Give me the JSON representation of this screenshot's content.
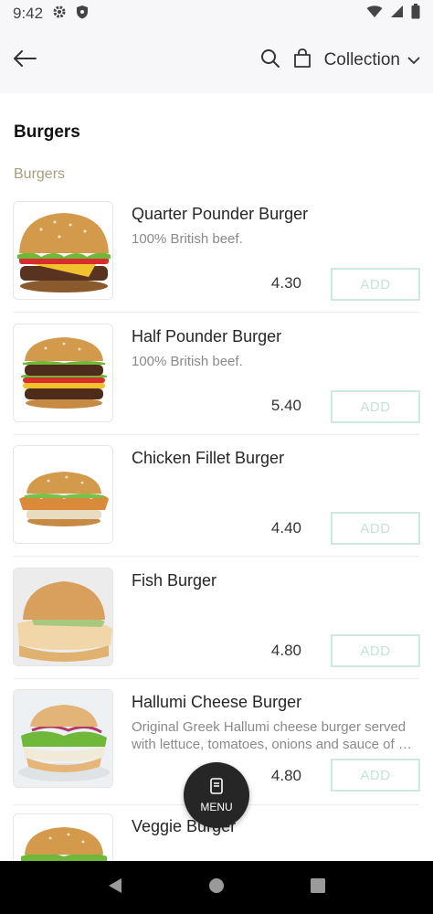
{
  "status": {
    "time": "9:42"
  },
  "header": {
    "collection_label": "Collection"
  },
  "page": {
    "title": "Burgers",
    "section": "Burgers"
  },
  "items": [
    {
      "name": "Quarter Pounder Burger",
      "desc": "100% British beef.",
      "price": "4.30",
      "add_label": "ADD"
    },
    {
      "name": "Half Pounder Burger",
      "desc": "100% British beef.",
      "price": "5.40",
      "add_label": "ADD"
    },
    {
      "name": "Chicken Fillet Burger",
      "desc": "",
      "price": "4.40",
      "add_label": "ADD"
    },
    {
      "name": "Fish Burger",
      "desc": "",
      "price": "4.80",
      "add_label": "ADD"
    },
    {
      "name": "Hallumi Cheese Burger",
      "desc": "Original Greek Hallumi cheese burger served with lettuce, tomatoes, onions and sauce of …",
      "price": "4.80",
      "add_label": "ADD"
    },
    {
      "name": "Veggie Burger",
      "desc": "",
      "price": "",
      "add_label": ""
    }
  ],
  "fab": {
    "label": "MENU"
  },
  "colors": {
    "accent_green": "#cfe8df",
    "section_olive": "#a4a07a",
    "header_bg": "#f7f6f8"
  }
}
